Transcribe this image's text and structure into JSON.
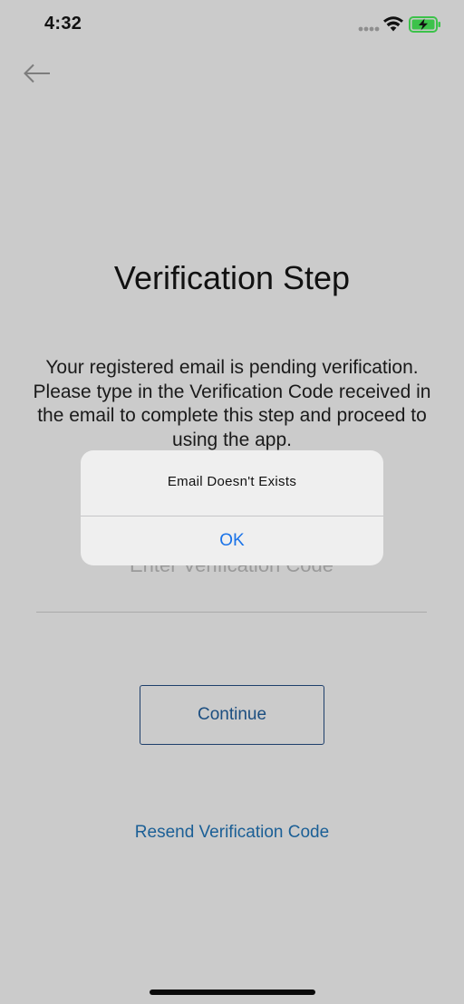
{
  "status_bar": {
    "time": "4:32",
    "icons": [
      "signal-icon",
      "wifi-icon",
      "battery-charging-icon"
    ],
    "battery_color": "#3cc24a"
  },
  "nav": {
    "back_icon": "arrow-left-icon"
  },
  "page": {
    "title": "Verification Step",
    "description": "Your registered email is pending verification. Please type in the Verification Code received in the email to complete this step and proceed to using the app."
  },
  "form": {
    "code_placeholder": "Enter Verification Code",
    "code_value": "",
    "continue_label": "Continue",
    "resend_label": "Resend Verification Code"
  },
  "alert": {
    "message": "Email Doesn't Exists",
    "ok_label": "OK"
  },
  "colors": {
    "background": "#cbcbcb",
    "button_border": "#1e3f6b",
    "link": "#1b5f96",
    "alert_ok": "#1a73e8"
  }
}
